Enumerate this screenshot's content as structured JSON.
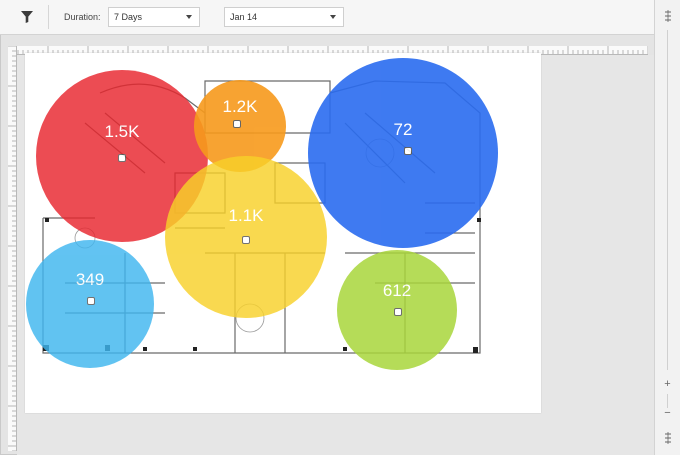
{
  "toolbar": {
    "filter_icon": "filter-icon",
    "duration_label": "Duration:",
    "duration_value": "7 Days",
    "date_value": "Jan 14"
  },
  "zoom": {
    "in_label": "+",
    "out_label": "−"
  },
  "heatmap": {
    "access_points": [
      {
        "id": "ap-red",
        "value": "1.5K",
        "color": "#e8262e"
      },
      {
        "id": "ap-orange",
        "value": "1.2K",
        "color": "#f79a1c"
      },
      {
        "id": "ap-blue",
        "value": "72",
        "color": "#2a6cf0"
      },
      {
        "id": "ap-yellow",
        "value": "1.1K",
        "color": "#f8d129"
      },
      {
        "id": "ap-cyan",
        "value": "349",
        "color": "#3fb6ef"
      },
      {
        "id": "ap-green",
        "value": "612",
        "color": "#a9d63b"
      }
    ]
  }
}
